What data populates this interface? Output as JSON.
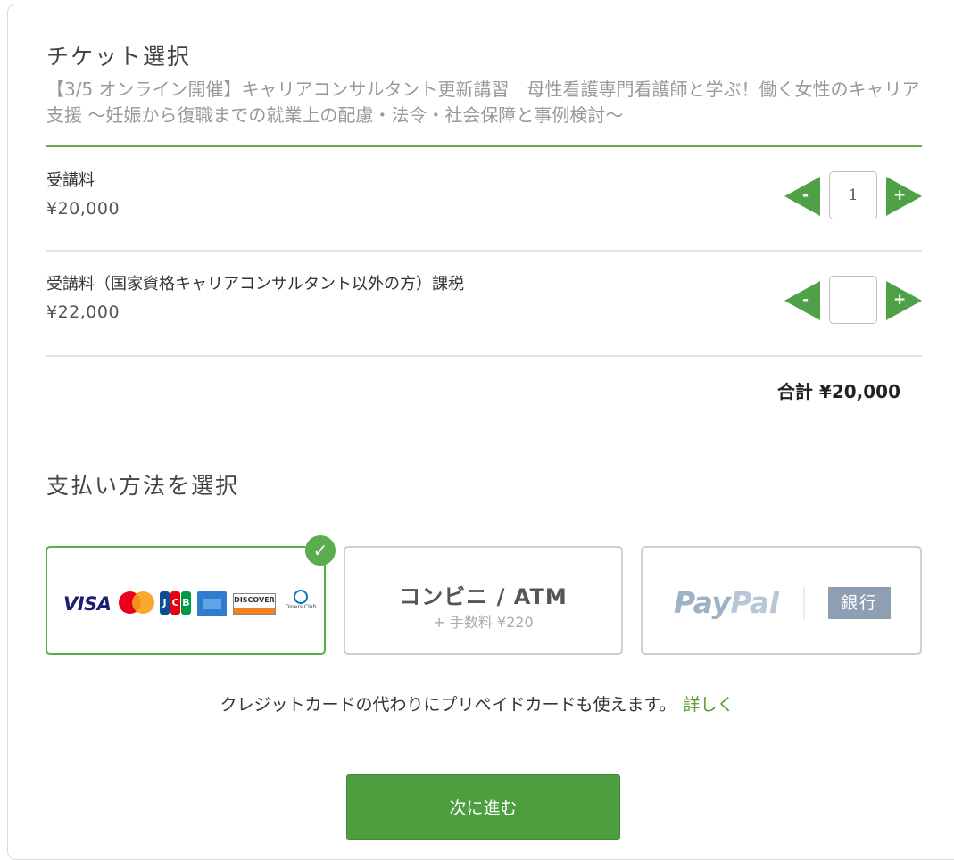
{
  "ticket_section": {
    "title": "チケット選択",
    "event_title": "【3/5 オンライン開催】キャリアコンサルタント更新講習　母性看護専門看護師と学ぶ！働く女性のキャリア支援 ～妊娠から復職までの就業上の配慮・法令・社会保障と事例検討～"
  },
  "tickets": [
    {
      "name": "受講料",
      "price": "¥20,000",
      "quantity": "1",
      "minus_label": "-",
      "plus_label": "+"
    },
    {
      "name": "受講料（国家資格キャリアコンサルタント以外の方）課税",
      "price": "¥22,000",
      "quantity": "",
      "minus_label": "-",
      "plus_label": "+"
    }
  ],
  "total": {
    "label": "合計",
    "value": "¥20,000"
  },
  "payment_section": {
    "title": "支払い方法を選択",
    "credit_card": {
      "selected": true,
      "check_glyph": "✓",
      "brands": [
        "VISA",
        "Mastercard",
        "JCB",
        "American Express",
        "DISCOVER",
        "Diners Club"
      ],
      "visa_text": "VISA",
      "jcb_text": [
        "J",
        "C",
        "B"
      ],
      "discover_text": "DISCOVER",
      "diners_text": "Diners Club"
    },
    "konbini": {
      "label": "コンビニ / ATM",
      "fee": "+ 手数料 ¥220"
    },
    "paypal_bank": {
      "paypal_a": "Pay",
      "paypal_b": "Pal",
      "bank_label": "銀行"
    }
  },
  "note": {
    "text": "クレジットカードの代わりにプリペイドカードも使えます。",
    "link": "詳しく"
  },
  "next_button": "次に進む",
  "colors": {
    "accent_green": "#4e9e3f",
    "section_line": "#6aa84f",
    "link_green": "#5a9a3b"
  }
}
